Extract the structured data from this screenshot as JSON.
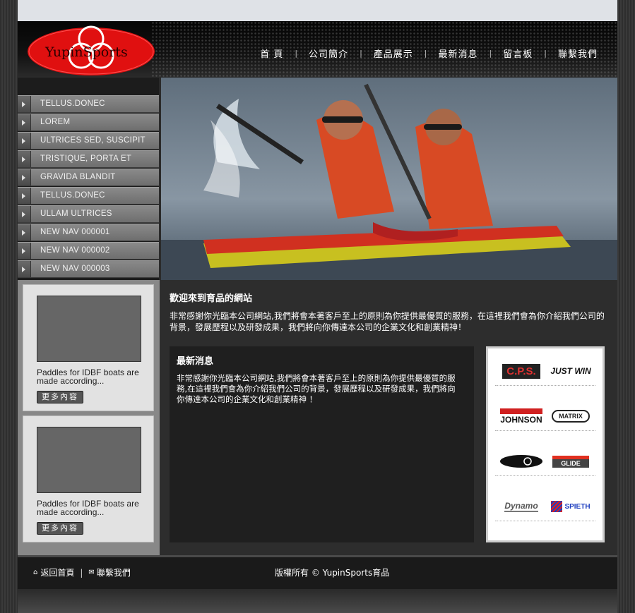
{
  "logo": {
    "text": "YupinSports"
  },
  "nav": {
    "items": [
      "首 頁",
      "公司簡介",
      "產品展示",
      "最新消息",
      "留言板",
      "聯繫我們"
    ]
  },
  "sidebar": {
    "items": [
      "TELLUS.DONEC",
      "LOREM",
      "ULTRICES SED, SUSCIPIT",
      "TRISTIQUE, PORTA ET",
      "GRAVIDA BLANDIT",
      "TELLUS.DONEC",
      "ULLAM ULTRICES",
      "NEW NAV 000001",
      "NEW NAV 000002",
      "NEW NAV 000003"
    ]
  },
  "cards": [
    {
      "text": "Paddles for IDBF boats are made according...",
      "button": "更多內容"
    },
    {
      "text": "Paddles for IDBF boats are made according...",
      "button": "更多內容"
    }
  ],
  "welcome": {
    "title": "歡迎來到育品的網站",
    "text": "非常感謝你光臨本公司網站,我們將會本著客戶至上的原則為你提供最優質的服務，在這裡我們會為你介紹我們公司的背景，發展歷程以及研發成果，我們將向你傳達本公司的企業文化和創業精神！"
  },
  "news": {
    "title": "最新消息",
    "text": "非常感謝你光臨本公司網站,我們將會本著客戶至上的原則為你提供最優質的服務,在這裡我們會為你介紹我們公司的背景，發展歷程以及研發成果，我們將向你傳達本公司的企業文化和創業精神 ！"
  },
  "brands": [
    [
      "C.P.S.",
      "JUST WIN"
    ],
    [
      "JOHNSON",
      "MATRIX"
    ],
    [
      "paddle",
      "GLIDE"
    ],
    [
      "Dynamo",
      "SPIETH"
    ]
  ],
  "footer": {
    "home": "返回首頁",
    "contact": "聯繫我們",
    "copyright": "版權所有 © YupinSports育品"
  },
  "colors": {
    "accent": "#e01010",
    "header": "#0a0a0a",
    "sidebar": "#7a7a7a"
  }
}
